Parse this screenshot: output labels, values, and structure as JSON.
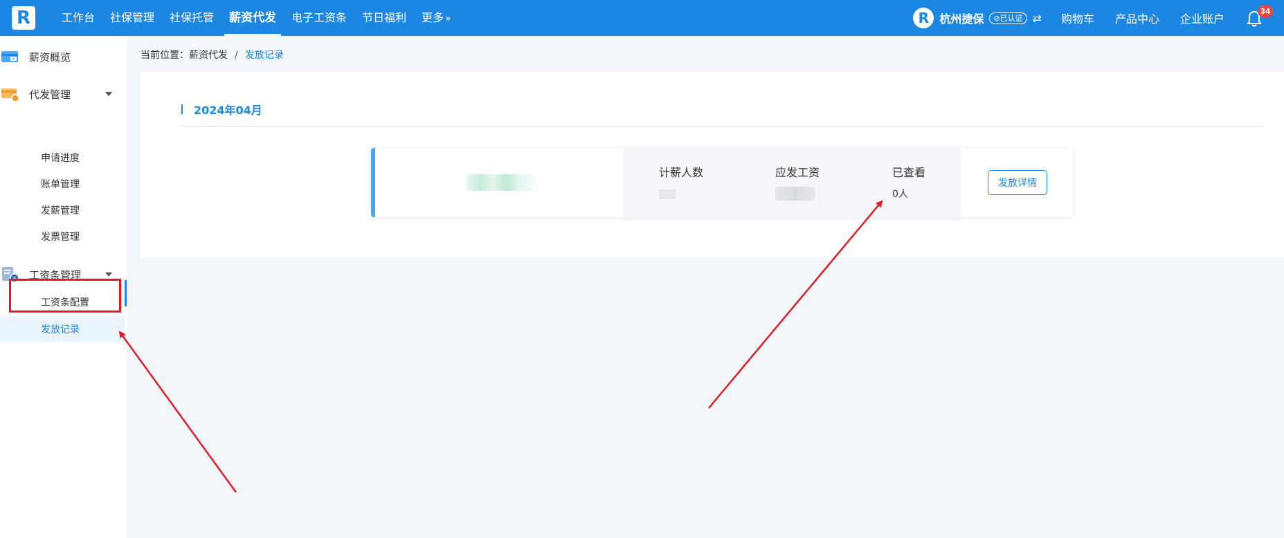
{
  "header": {
    "logo_letter": "R",
    "nav": [
      {
        "label": "工作台"
      },
      {
        "label": "社保管理"
      },
      {
        "label": "社保托管"
      },
      {
        "label": "薪资代发"
      },
      {
        "label": "电子工资条"
      },
      {
        "label": "节日福利"
      },
      {
        "label": "更多"
      }
    ],
    "active_nav": "薪资代发",
    "company_logo_letter": "R",
    "company_name": "杭州捷保",
    "verified_label": "⊘已认证",
    "links": [
      {
        "label": "购物车"
      },
      {
        "label": "产品中心"
      },
      {
        "label": "企业账户"
      }
    ],
    "notification_count": "34"
  },
  "sidebar": {
    "overview_label": "薪资概览",
    "groups": [
      {
        "label": "代发管理",
        "items": [
          {
            "label": "申请进度"
          },
          {
            "label": "账单管理"
          },
          {
            "label": "发薪管理"
          },
          {
            "label": "发票管理"
          }
        ]
      },
      {
        "label": "工资条管理",
        "items": [
          {
            "label": "工资条配置"
          },
          {
            "label": "发放记录"
          }
        ]
      }
    ],
    "active_item": "发放记录"
  },
  "breadcrumb": {
    "prefix": "当前位置：薪资代发",
    "separator": "/",
    "current": "发放记录"
  },
  "records": {
    "month": "2024年04月",
    "items": [
      {
        "stats": [
          {
            "label": "计薪人数",
            "value": ""
          },
          {
            "label": "应发工资",
            "value": ""
          },
          {
            "label": "已查看",
            "value": "0人"
          }
        ],
        "detail_button": "发放详情"
      }
    ]
  },
  "colors": {
    "primary": "#1c86e3",
    "annotation": "#e31b23",
    "badge": "#f5433b"
  }
}
